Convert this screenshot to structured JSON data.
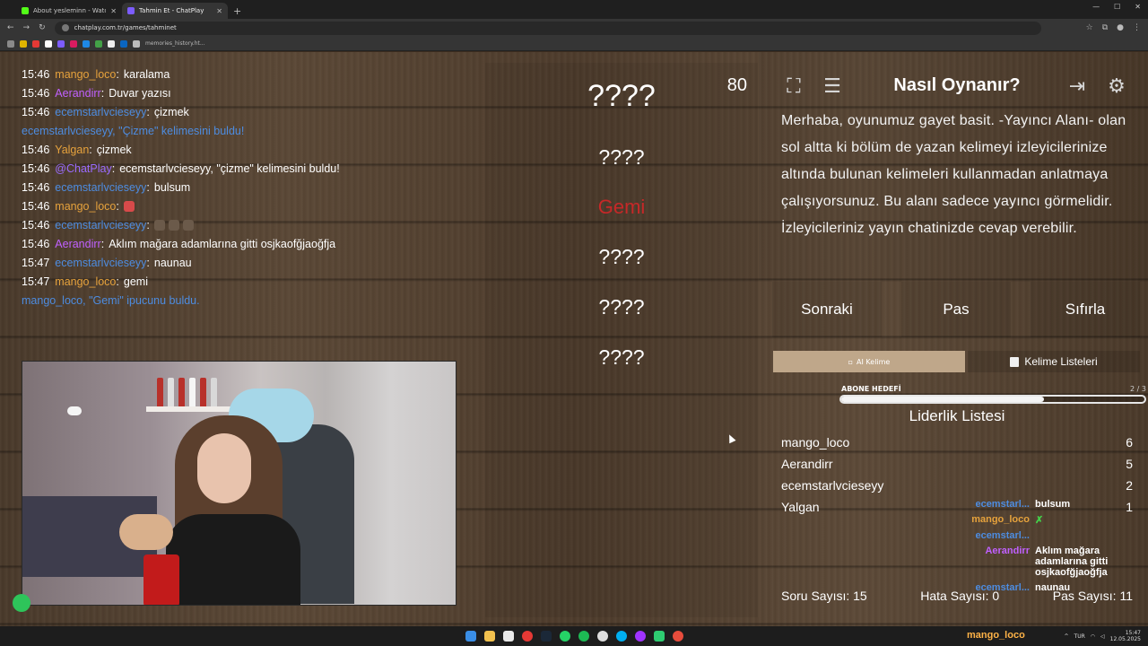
{
  "browser": {
    "tabs": [
      {
        "title": "About yesleminn - Watch Live o",
        "favicon_color": "#53fc18"
      },
      {
        "title": "Tahmin Et - ChatPlay",
        "favicon_color": "#7c5cff"
      }
    ],
    "url": "chatplay.com.tr/games/tahminet",
    "bookmark_label": "memories_history.ht..."
  },
  "chat": {
    "lines": [
      {
        "time": "15:46",
        "user": "mango_loco",
        "user_color": "#e6a23c",
        "message": "karalama"
      },
      {
        "time": "15:46",
        "user": "Aerandirr",
        "user_color": "#c060ff",
        "message": "Duvar yazısı"
      },
      {
        "time": "15:46",
        "user": "ecemstarlvcieseyy",
        "user_color": "#4d8ce0",
        "message": "çizmek"
      },
      {
        "time": "",
        "user": "ecemstarlvcieseyy,",
        "user_color": "#4d8ce0",
        "message": "\"Çizme\" kelimesini buldu!",
        "system": true
      },
      {
        "time": "15:46",
        "user": "Yalgan",
        "user_color": "#e6a23c",
        "message": "çizmek"
      },
      {
        "time": "15:46",
        "user": "@ChatPlay",
        "user_color": "#9a6bff",
        "message": "ecemstarlvcieseyy, \"çizme\" kelimesini buldu!"
      },
      {
        "time": "15:46",
        "user": "ecemstarlvcieseyy",
        "user_color": "#4d8ce0",
        "message": "bulsum"
      },
      {
        "time": "15:46",
        "user": "mango_loco",
        "user_color": "#e6a23c",
        "message": ""
      },
      {
        "time": "15:46",
        "user": "ecemstarlvcieseyy",
        "user_color": "#4d8ce0",
        "message": ""
      },
      {
        "time": "15:46",
        "user": "Aerandirr",
        "user_color": "#c060ff",
        "message": "Aklım mağara adamlarına gitti osjkaofğjaoğfja"
      },
      {
        "time": "15:47",
        "user": "ecemstarlvcieseyy",
        "user_color": "#4d8ce0",
        "message": "naunau"
      },
      {
        "time": "15:47",
        "user": "mango_loco",
        "user_color": "#e6a23c",
        "message": "gemi"
      },
      {
        "time": "",
        "user": "mango_loco,",
        "user_color": "#4d8ce0",
        "message": "\"Gemi\" ipucunu buldu.",
        "system": true
      }
    ]
  },
  "words": {
    "count": "80",
    "items": [
      {
        "text": "????",
        "size": "big",
        "state": "hidden"
      },
      {
        "text": "????",
        "size": "med",
        "state": "hidden"
      },
      {
        "text": "Gemi",
        "size": "found",
        "state": "found"
      },
      {
        "text": "????",
        "size": "med",
        "state": "hidden"
      },
      {
        "text": "????",
        "size": "med",
        "state": "hidden"
      },
      {
        "text": "????",
        "size": "med",
        "state": "hidden"
      }
    ]
  },
  "howto": {
    "title": "Nasıl Oynanır?",
    "text": "Merhaba, oyunumuz gayet basit. -Yayıncı Alanı- olan sol altta ki bölüm de yazan kelimeyi izleyicilerinize altında bulunan kelimeleri kullanmadan anlatmaya çalışıyorsunuz. Bu alanı sadece yayıncı görmelidir. İzleyicileriniz yayın chatinizde cevap verebilir."
  },
  "actions": {
    "next": "Sonraki",
    "pass": "Pas",
    "reset": "Sıfırla"
  },
  "tabs": {
    "ai": "AI Kelime",
    "lists": "Kelime Listeleri"
  },
  "sub_goal": {
    "label": "ABONE HEDEFİ",
    "count": "2 / 3",
    "progress": 0.67
  },
  "leaderboard": {
    "title": "Liderlik Listesi",
    "rows": [
      {
        "name": "mango_loco",
        "score": "6"
      },
      {
        "name": "Aerandirr",
        "score": "5"
      },
      {
        "name": "ecemstarlvcieseyy",
        "score": "2"
      },
      {
        "name": "Yalgan",
        "score": "1"
      }
    ],
    "questions": "Soru Sayısı: 15",
    "errors": "Hata Sayısı: 0",
    "passes": "Pas Sayısı: 11"
  },
  "overlay_chat": [
    {
      "user": "ecemstarl...",
      "color": "#4d8ce0",
      "message": "bulsum"
    },
    {
      "user": "mango_loco",
      "color": "#e6a23c",
      "message": "✗"
    },
    {
      "user": "ecemstarl...",
      "color": "#4d8ce0",
      "message": ""
    },
    {
      "user": "Aerandirr",
      "color": "#c060ff",
      "message": "Aklım mağara adamlarına gitti osjkaofğjaoğfja"
    },
    {
      "user": "ecemstarl...",
      "color": "#4d8ce0",
      "message": "naunau"
    }
  ],
  "taskbar": {
    "username": "mango_loco",
    "lang": "TUR",
    "time": "15:47",
    "date": "12.05.2025"
  },
  "icons": [
    "fullscreen-icon",
    "notes-icon",
    "exit-icon",
    "settings-icon",
    "list-icon"
  ]
}
